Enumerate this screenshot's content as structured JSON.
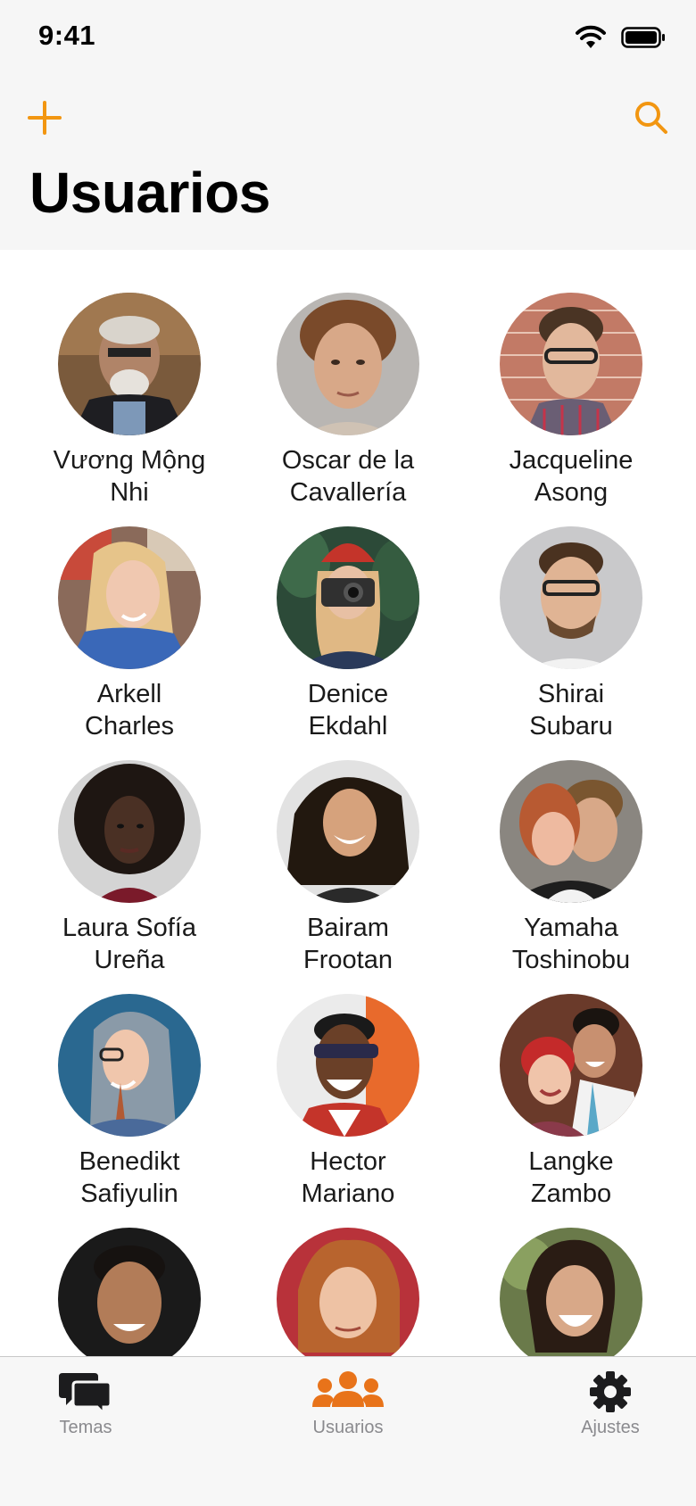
{
  "status_bar": {
    "time": "9:41"
  },
  "header": {
    "title": "Usuarios",
    "add_icon": "plus-icon",
    "search_icon": "search-icon",
    "accent_color": "#f29611"
  },
  "users": [
    {
      "name": "Vương Mộng\nNhi"
    },
    {
      "name": "Oscar de la\nCavallería"
    },
    {
      "name": "Jacqueline\nAsong"
    },
    {
      "name": "Arkell\nCharles"
    },
    {
      "name": "Denice\nEkdahl"
    },
    {
      "name": "Shirai\nSubaru"
    },
    {
      "name": "Laura Sofía\nUreña"
    },
    {
      "name": "Bairam\nFrootan"
    },
    {
      "name": "Yamaha\nToshinobu"
    },
    {
      "name": "Benedikt\nSafiyulin"
    },
    {
      "name": "Hector\nMariano"
    },
    {
      "name": "Langke\nZambo"
    },
    {
      "name": ""
    },
    {
      "name": ""
    },
    {
      "name": ""
    }
  ],
  "tab_bar": {
    "tabs": [
      {
        "label": "Temas",
        "icon": "chat-bubbles-icon",
        "active": false
      },
      {
        "label": "Usuarios",
        "icon": "users-group-icon",
        "active": true
      },
      {
        "label": "Ajustes",
        "icon": "gear-icon",
        "active": false
      }
    ],
    "active_color": "#e8731a",
    "inactive_color": "#1c1c1e"
  }
}
